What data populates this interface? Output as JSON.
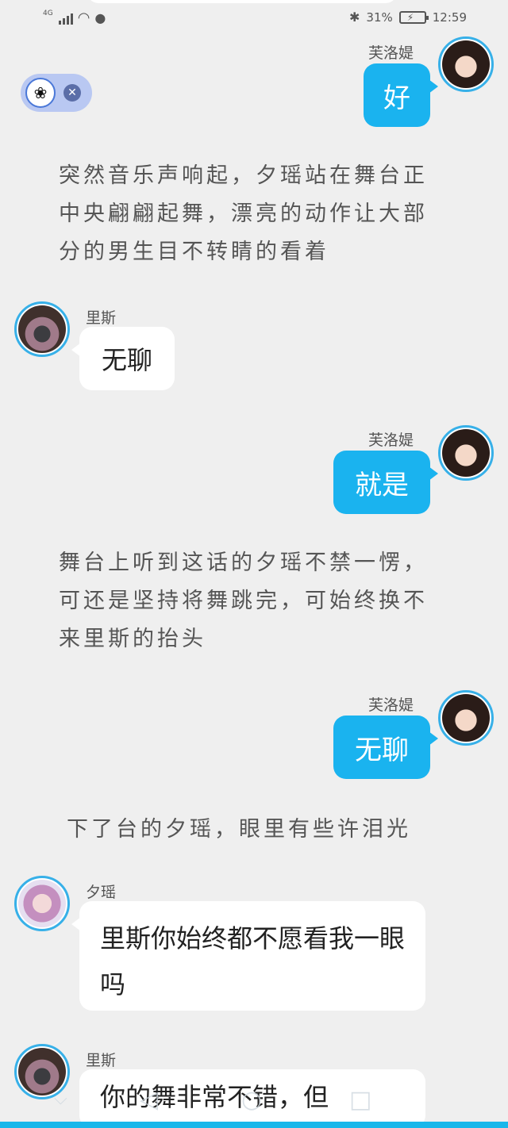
{
  "status_bar": {
    "network": "4G",
    "battery": "31%",
    "time": "12:59"
  },
  "float_widget": {
    "icon": "paw-icon",
    "close_icon": "close-icon"
  },
  "messages": [
    {
      "sender": "芙洛媞",
      "text": "好"
    },
    {
      "narration": "突然音乐声响起，夕瑶站在舞台正中央翩翩起舞，漂亮的动作让大部分的男生目不转睛的看着"
    },
    {
      "sender": "里斯",
      "text": "无聊"
    },
    {
      "sender": "芙洛媞",
      "text": "就是"
    },
    {
      "narration": "舞台上听到这话的夕瑶不禁一愣，可还是坚持将舞跳完，可始终换不来里斯的抬头"
    },
    {
      "sender": "芙洛媞",
      "text": "无聊"
    },
    {
      "narration": "下了台的夕瑶，眼里有些许泪光"
    },
    {
      "sender": "夕瑶",
      "text": "里斯你始终都不愿看我一眼吗"
    },
    {
      "sender": "里斯",
      "text": "你的舞非常不错，但"
    }
  ],
  "colors": {
    "accent": "#1ab3ef",
    "background": "#efefef",
    "bubble_other": "#ffffff"
  }
}
